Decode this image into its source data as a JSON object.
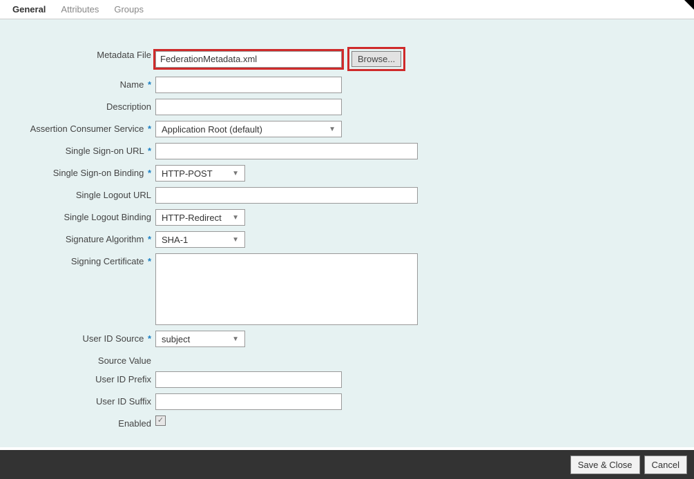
{
  "tabs": {
    "general": "General",
    "attributes": "Attributes",
    "groups": "Groups"
  },
  "labels": {
    "metadata_file": "Metadata File",
    "name": "Name",
    "description": "Description",
    "acs": "Assertion Consumer Service",
    "sso_url": "Single Sign-on URL",
    "sso_binding": "Single Sign-on Binding",
    "slo_url": "Single Logout URL",
    "slo_binding": "Single Logout Binding",
    "sig_algo": "Signature Algorithm",
    "signing_cert": "Signing Certificate",
    "uid_source": "User ID Source",
    "source_value": "Source Value",
    "uid_prefix": "User ID Prefix",
    "uid_suffix": "User ID Suffix",
    "enabled": "Enabled"
  },
  "values": {
    "metadata_file": "FederationMetadata.xml",
    "name": "",
    "description": "",
    "acs": "Application Root (default)",
    "sso_url": "",
    "sso_binding": "HTTP-POST",
    "slo_url": "",
    "slo_binding": "HTTP-Redirect",
    "sig_algo": "SHA-1",
    "signing_cert": "",
    "uid_source": "subject",
    "uid_prefix": "",
    "uid_suffix": "",
    "enabled": true
  },
  "buttons": {
    "browse": "Browse...",
    "save_close": "Save & Close",
    "cancel": "Cancel"
  },
  "glyphs": {
    "req": "*",
    "check": "✓"
  }
}
